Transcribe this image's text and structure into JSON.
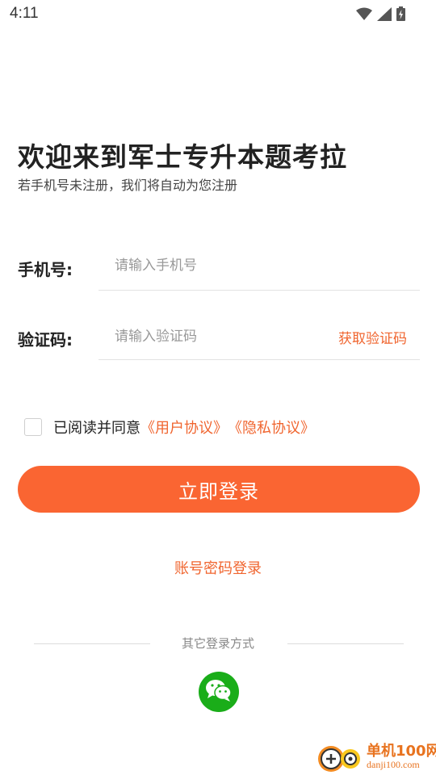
{
  "status_bar": {
    "time": "4:11"
  },
  "header": {
    "title": "欢迎来到军士专升本题考拉",
    "subtitle": "若手机号未注册，我们将自动为您注册"
  },
  "form": {
    "phone_label": "手机号:",
    "phone_placeholder": "请输入手机号",
    "phone_value": "",
    "code_label": "验证码:",
    "code_placeholder": "请输入验证码",
    "code_value": "",
    "get_code_label": "获取验证码"
  },
  "agreement": {
    "checked": false,
    "text": "已阅读并同意",
    "user_agreement": "《用户协议》",
    "privacy_policy": "《隐私协议》"
  },
  "login_button": "立即登录",
  "alt_login_link": "账号密码登录",
  "other_login": {
    "divider_text": "其它登录方式",
    "wechat_icon": "wechat-icon"
  },
  "watermark": {
    "title": "单机100网",
    "subtitle": "danji100.com"
  },
  "colors": {
    "accent": "#fa6532",
    "link": "#f0652f",
    "wechat": "#1aad19"
  }
}
